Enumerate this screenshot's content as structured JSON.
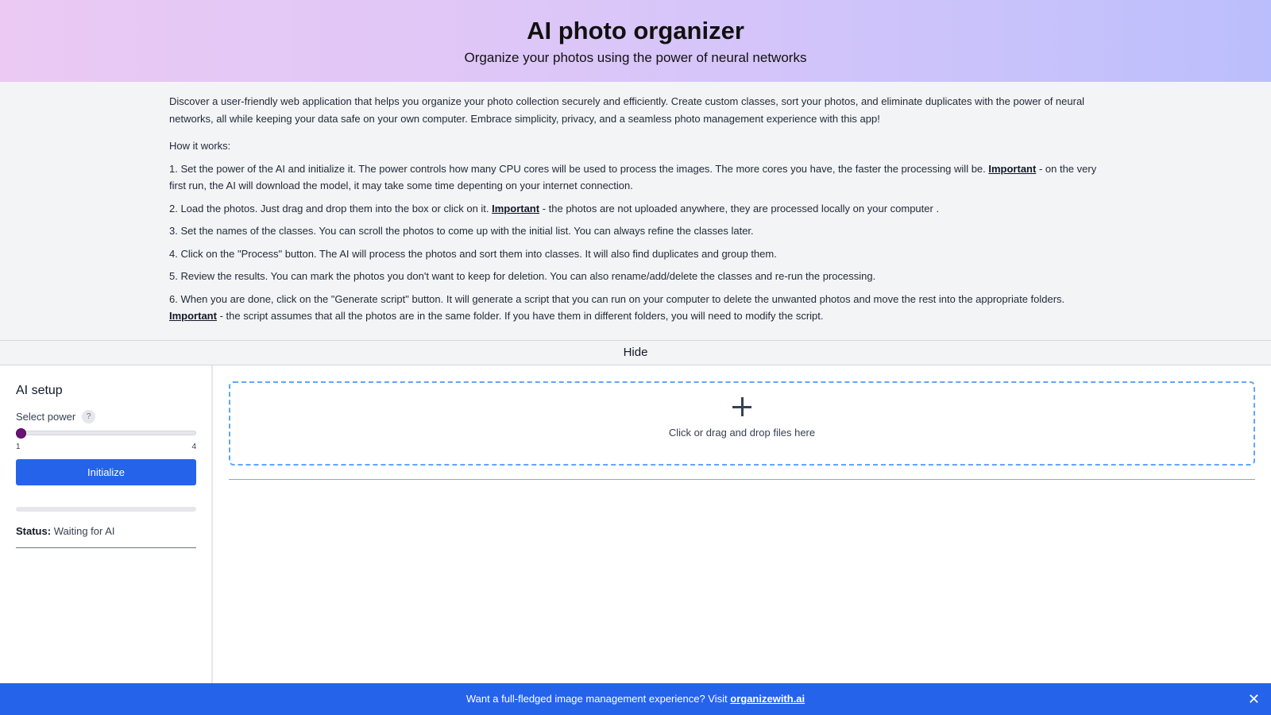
{
  "header": {
    "title": "AI photo organizer",
    "subtitle": "Organize your photos using the power of neural networks"
  },
  "about": {
    "intro": "Discover a user-friendly web application that helps you organize your photo collection securely and efficiently. Create custom classes, sort your photos, and eliminate duplicates with the power of neural networks, all while keeping your data safe on your own computer. Embrace simplicity, privacy, and a seamless photo management experience with this app!",
    "how_title": "How it works:",
    "important_label": "Important",
    "steps": [
      {
        "before": "1. Set the power of the AI and initialize it. The power controls how many CPU cores will be used to process the images. The more cores you have, the faster the processing will be. ",
        "after": " - on the very first run, the AI will download the model, it may take some time depenting on your internet connection."
      },
      {
        "before": "2. Load the photos. Just drag and drop them into the box or click on it. ",
        "after": " - the photos are not uploaded anywhere, they are processed locally on your computer ."
      },
      {
        "text": "3. Set the names of the classes. You can scroll the photos to come up with the initial list. You can always refine the classes later."
      },
      {
        "text": "4. Click on the \"Process\" button. The AI will process the photos and sort them into classes. It will also find duplicates and group them."
      },
      {
        "text": "5. Review the results. You can mark the photos you don't want to keep for deletion. You can also rename/add/delete the classes and re-run the processing."
      },
      {
        "before": "6. When you are done, click on the \"Generate script\" button. It will generate a script that you can run on your computer to delete the unwanted photos and move the rest into the appropriate folders. ",
        "after": " - the script assumes that all the photos are in the same folder. If you have them in different folders, you will need to modify the script."
      }
    ]
  },
  "hide_label": "Hide",
  "sidebar": {
    "title": "AI setup",
    "power_label": "Select power",
    "help_glyph": "?",
    "slider_min": "1",
    "slider_max": "4",
    "slider_value": 1,
    "initialize_label": "Initialize",
    "progress": 0,
    "status_label": "Status:",
    "status_value": "Waiting for AI"
  },
  "dropzone": {
    "icon": "plus-icon",
    "text": "Click or drag and drop files here"
  },
  "banner": {
    "text": "Want a full-fledged image management experience? Visit ",
    "link": "organizewith.ai",
    "close_glyph": "✕"
  },
  "colors": {
    "accent": "#2563eb",
    "slider_thumb": "#6b0f7a",
    "dropzone_border": "#60a5fa"
  }
}
